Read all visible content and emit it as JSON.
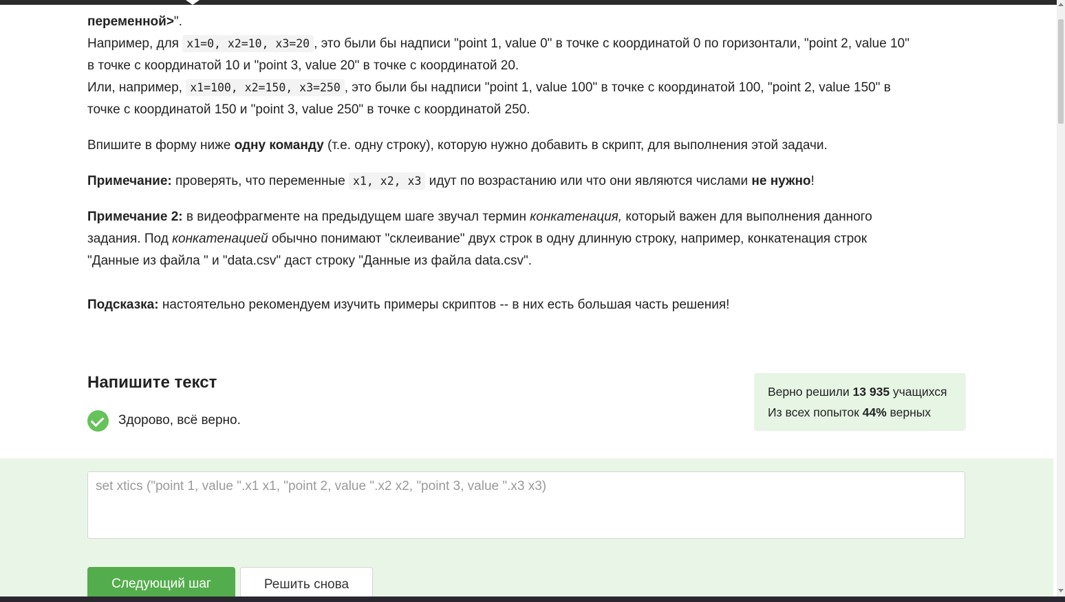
{
  "task": {
    "line0_bold": "переменной>",
    "line0_tail": "\".",
    "ex1_a": "Например, для ",
    "ex1_code": "x1=0, x2=10, x3=20",
    "ex1_b": ", это были бы надписи \"point 1, value 0\" в точке с координатой 0 по горизонтали,  \"point 2, value 10\"",
    "ex1_c": "в точке с координатой 10 и  \"point 3, value 20\" в точке с координатой 20.",
    "ex2_a": "Или, например, ",
    "ex2_code": "x1=100, x2=150, x3=250",
    "ex2_b": ", это были бы надписи \"point 1, value 100\" в точке с координатой 100, \"point 2, value 150\" в",
    "ex2_c": "точке с координатой 150 и \"point 3, value 250\" в точке с координатой 250.",
    "instr_a": "Впишите в форму ниже ",
    "instr_bold": "одну команду",
    "instr_b": " (т.е. одну строку), которую нужно добавить в скрипт, для выполнения этой задачи.",
    "note1_label": "Примечание:",
    "note1_a": " проверять, что переменные ",
    "note1_code": "x1, x2, x3",
    "note1_b": " идут по возрастанию или что они являются числами ",
    "note1_bold": "не нужно",
    "note1_c": "!",
    "note2_label": "Примечание 2:",
    "note2_a": " в видеофрагменте на предыдущем шаге звучал термин ",
    "note2_italic": "конкатенация,",
    "note2_b": " который важен для выполнения данного",
    "note2_c": "задания. Под ",
    "note2_italic2": "конкатенацией",
    "note2_d": " обычно понимают \"склеивание\" двух строк в одну длинную строку, например, конкатенация строк",
    "note2_e": "\"Данные из файла \" и \"data.csv\" даст строку \"Данные из файла data.csv\".",
    "hint_label": "Подсказка:",
    "hint_text": " настоятельно рекомендуем изучить примеры скриптов -- в них есть большая часть решения!"
  },
  "answer_section": {
    "title": "Напишите текст",
    "status": "Здорово, всё верно.",
    "answer_value": "set xtics (\"point 1, value \".x1 x1, \"point 2, value \".x2 x2, \"point 3, value \".x3 x3)",
    "next_button": "Следующий шаг",
    "retry_button": "Решить снова"
  },
  "stats": {
    "solved_prefix": "Верно решили ",
    "solved_count": "13 935",
    "solved_suffix": " учащихся",
    "attempts_prefix": "Из всех попыток ",
    "attempts_percent": "44%",
    "attempts_suffix": " верных"
  },
  "colors": {
    "accent_green": "#54ad4c",
    "success_check": "#66c25a",
    "answer_panel_bg": "#e9f6e7",
    "stats_bg": "#e6f5e4"
  },
  "icons": [
    "check-circle-icon"
  ]
}
